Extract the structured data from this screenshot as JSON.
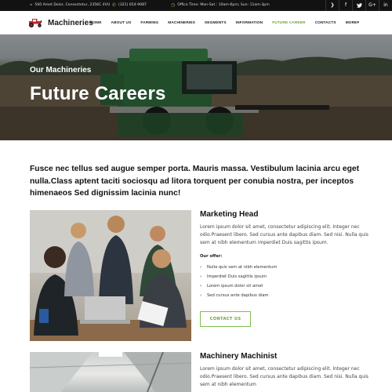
{
  "topbar": {
    "address": "560 Amet Dolor, Consectetur, 2356C 4VU",
    "phone": "(321) 654-9087",
    "hours": "Office Time: Mon-Sat : 10am-6pm; Sun: 11am-3pm",
    "socials": [
      "rss-icon",
      "facebook-icon",
      "twitter-icon",
      "google-plus-icon",
      "linkedin-icon"
    ],
    "social_glyphs": [
      "❯",
      "f",
      "🐦",
      "G+",
      "in"
    ]
  },
  "nav": {
    "logo_text": "Machineries",
    "items": [
      "HOME",
      "ABOUT US",
      "FARMING",
      "MACHINERIES",
      "SEGMENTS",
      "INFORMATION",
      "FUTURE CAREER",
      "CONTACTS",
      "MORE▾"
    ],
    "active_item": "FUTURE CAREER",
    "accent": "#6ba43a"
  },
  "hero": {
    "subtitle": "Our Machineries",
    "title": "Future Careers"
  },
  "intro": "Fusce nec tellus sed augue semper porta. Mauris massa. Vestibulum lacinia arcu eget nulla.Class aptent taciti sociosqu ad litora torquent per conubia nostra, per inceptos himenaeos Sed dignissim lacinia nunc!",
  "jobs": [
    {
      "title": "Marketing Head",
      "description": "Lorem ipsum dolor sit amet, consectetur adipiscing elit. Integer nec odio.Praesent libero. Sed cursus ante dapibus diam. Sed nisi. Nulla quis sem at nibh elementum imperdiet Duis sagittis ipsum.",
      "offer_label": "Our offer:",
      "offers": [
        "Nulla quis sem at nibh elementum",
        "Imperdiet Duis sagittis ipsum",
        "Lorem ipsum dolor sit amet",
        "Sed cursus ante dapibus diam"
      ],
      "button": "CONTACT US"
    },
    {
      "title": "Machinery Machinist",
      "description": "Lorem ipsum dolor sit amet, consectetur adipiscing elit. Integer nec odio.Praesent libero. Sed cursus ante dapibus diam. Sed nisi. Nulla quis sem at nibh elementum"
    }
  ]
}
